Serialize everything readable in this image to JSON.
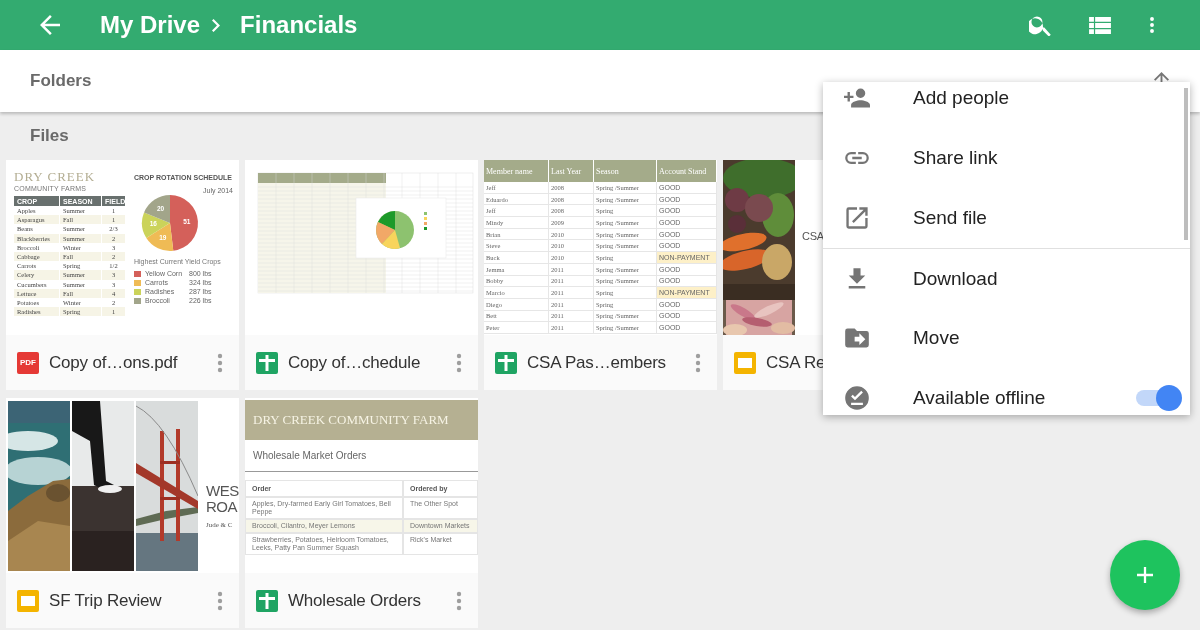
{
  "app_bar": {
    "breadcrumb": [
      "My Drive",
      "Financials"
    ]
  },
  "folders": {
    "label": "Folders"
  },
  "files_label": "Files",
  "files": [
    {
      "name": "Copy of…ons.pdf",
      "kind": "pdf",
      "badge": "PDF",
      "thumb": {
        "kind": "crop_schedule",
        "brand": "DRY CREEK",
        "subtitle": "COMMUNITY FARMS",
        "title": "CROP ROTATION SCHEDULE",
        "date": "July 2014",
        "columns": [
          "CROP",
          "SEASON",
          "FIELD"
        ],
        "rows": [
          [
            "Apples",
            "Summer",
            "1"
          ],
          [
            "Asparagus",
            "Fall",
            "1"
          ],
          [
            "Beans",
            "Summer",
            "2/3"
          ],
          [
            "Blackberries",
            "Summer",
            "2"
          ],
          [
            "Broccoli",
            "Winter",
            "3"
          ],
          [
            "Cabbage",
            "Fall",
            "2"
          ],
          [
            "Carrots",
            "Spring",
            "1/2"
          ],
          [
            "Celery",
            "Summer",
            "3"
          ],
          [
            "Cucumbers",
            "Summer",
            "3"
          ],
          [
            "Lettuce",
            "Fall",
            "4"
          ],
          [
            "Potatoes",
            "Winter",
            "2"
          ],
          [
            "Radishes",
            "Spring",
            "1"
          ]
        ],
        "chart_data": {
          "type": "pie",
          "title": "Highest Current Yield Crops",
          "categories": [
            "Yellow Corn",
            "Carrots",
            "Radishes",
            "Broccoli"
          ],
          "values": [
            51,
            19,
            16,
            20
          ],
          "data_labels": true,
          "legend": "bottom"
        },
        "legend_amounts": [
          "800 lbs",
          "324 lbs",
          "287 lbs",
          "226 lbs"
        ]
      }
    },
    {
      "name": "Copy of…chedule",
      "kind": "sheets",
      "thumb": {
        "kind": "sheet_chart"
      }
    },
    {
      "name": "CSA Pas…embers",
      "kind": "sheets",
      "thumb": {
        "kind": "member_table",
        "columns": [
          "Member name",
          "Last Year",
          "Season",
          "Account Stand"
        ],
        "rows": [
          {
            "cells": [
              "Jeff",
              "2008",
              "Spring /Summer",
              "GOOD"
            ],
            "flagged": false
          },
          {
            "cells": [
              "Eduardo",
              "2008",
              "Spring /Summer",
              "GOOD"
            ],
            "flagged": false
          },
          {
            "cells": [
              "Jeff",
              "2008",
              "Spring",
              "GOOD"
            ],
            "flagged": false
          },
          {
            "cells": [
              "Mindy",
              "2009",
              "Spring /Summer",
              "GOOD"
            ],
            "flagged": false
          },
          {
            "cells": [
              "Brian",
              "2010",
              "Spring /Summer",
              "GOOD"
            ],
            "flagged": false
          },
          {
            "cells": [
              "Steve",
              "2010",
              "Spring /Summer",
              "GOOD"
            ],
            "flagged": false
          },
          {
            "cells": [
              "Buck",
              "2010",
              "Spring",
              "NON-PAYMENT"
            ],
            "flagged": true
          },
          {
            "cells": [
              "Jemma",
              "2011",
              "Spring /Summer",
              "GOOD"
            ],
            "flagged": false
          },
          {
            "cells": [
              "Bobby",
              "2011",
              "Spring /Summer",
              "GOOD"
            ],
            "flagged": false
          },
          {
            "cells": [
              "Marcio",
              "2011",
              "Spring",
              "NON-PAYMENT"
            ],
            "flagged": true
          },
          {
            "cells": [
              "Diego",
              "2011",
              "Spring",
              "GOOD"
            ],
            "flagged": false
          },
          {
            "cells": [
              "Bett",
              "2011",
              "Spring /Summer",
              "GOOD"
            ],
            "flagged": false
          },
          {
            "cells": [
              "Peter",
              "2011",
              "Spring /Summer",
              "GOOD"
            ],
            "flagged": false
          }
        ]
      }
    },
    {
      "name": "CSA Re",
      "kind": "slides",
      "thumb": {
        "kind": "produce_cover",
        "heading": "CSA"
      }
    },
    {
      "name": "SF Trip Review",
      "kind": "slides",
      "thumb": {
        "kind": "trip_cover",
        "lines": [
          "WES",
          "ROA"
        ],
        "byline": "Jude & C"
      }
    },
    {
      "name": "Wholesale Orders",
      "kind": "sheets",
      "thumb": {
        "kind": "orders_sheet",
        "banner": "DRY CREEK COMMUNITY FARM",
        "title": "Wholesale Market Orders",
        "columns": [
          "Order",
          "Ordered by"
        ],
        "rows": [
          [
            "Apples, Dry-farmed Early Girl Tomatoes, Bell Peppe",
            "The Other Spot"
          ],
          [
            "Broccoli, Cilantro, Meyer Lemons",
            "Downtown Markets"
          ],
          [
            "Strawberries, Potatoes, Heirloom Tomatoes, Leeks, Patty Pan Summer Squash",
            "Rick's Market"
          ]
        ]
      }
    }
  ],
  "menu": [
    {
      "kind": "action",
      "label": "Add people",
      "divider_before": false
    },
    {
      "kind": "action",
      "label": "Share link",
      "divider_before": false
    },
    {
      "kind": "action",
      "label": "Send file",
      "divider_before": false
    },
    {
      "kind": "action",
      "label": "Download",
      "divider_before": true
    },
    {
      "kind": "action",
      "label": "Move",
      "divider_before": false
    },
    {
      "kind": "toggle",
      "label": "Available offline",
      "divider_before": false,
      "on": true
    }
  ]
}
